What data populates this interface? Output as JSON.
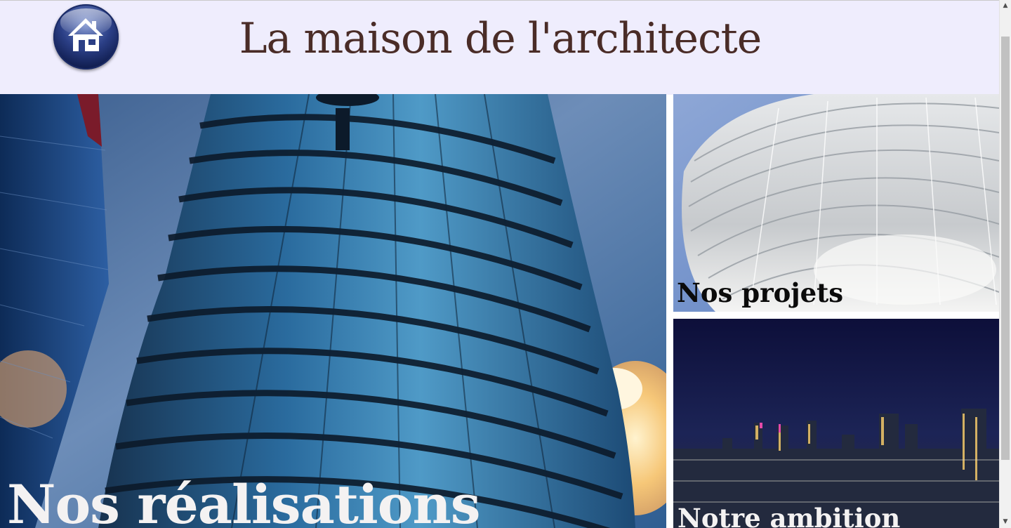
{
  "header": {
    "home_icon": "home-icon",
    "title": "La maison de l'architecte"
  },
  "tiles": [
    {
      "label": "Nos réalisations",
      "image": "glass-skyscraper-photo"
    },
    {
      "label": "Nos projets",
      "image": "white-steel-canopy-photo"
    },
    {
      "label": "Notre ambition",
      "image": "night-city-skyline-photo"
    }
  ],
  "scrollbar": {
    "up_icon": "scroll-up-arrow-icon",
    "down_icon": "scroll-down-arrow-icon"
  },
  "colors": {
    "header_bg": "#efedfd",
    "title_text": "#4a2c27",
    "home_button": "#1f2f6e",
    "label_light": "#f4f2f2",
    "label_dark": "#0b0b0b"
  }
}
